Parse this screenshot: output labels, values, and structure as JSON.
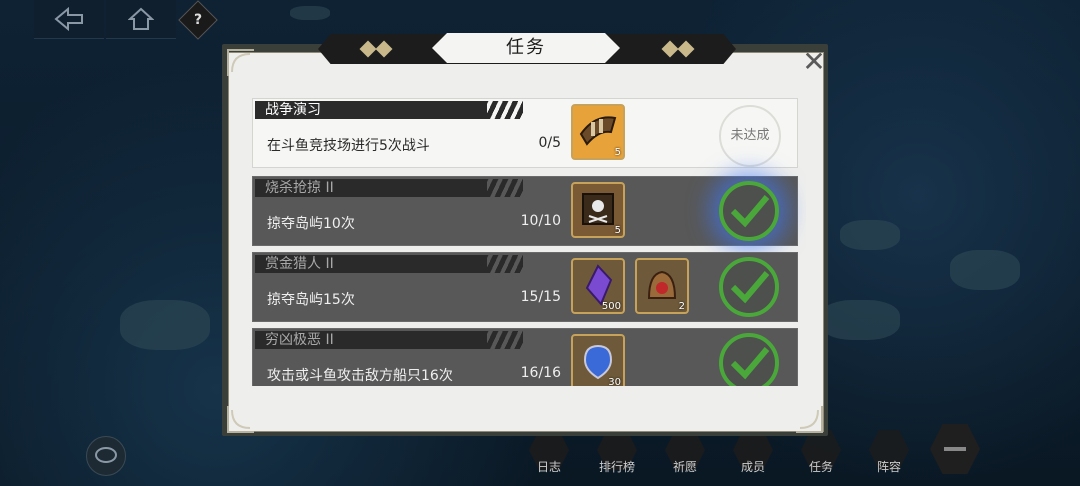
{
  "dialog": {
    "title": "任务"
  },
  "quests": [
    {
      "name": "战争演习",
      "desc": "在斗鱼竞技场进行5次战斗",
      "progress": "0/5",
      "status": "active",
      "status_label": "未达成",
      "rewards": [
        {
          "icon": "horn-icon",
          "count": "5"
        }
      ]
    },
    {
      "name": "烧杀抢掠 II",
      "desc": "掠夺岛屿10次",
      "progress": "10/10",
      "status": "done",
      "rewards": [
        {
          "icon": "pirate-map-icon",
          "count": "5"
        }
      ]
    },
    {
      "name": "赏金猎人 II",
      "desc": "掠夺岛屿15次",
      "progress": "15/15",
      "status": "done",
      "rewards": [
        {
          "icon": "purple-crystal-icon",
          "count": "500"
        },
        {
          "icon": "bell-icon",
          "count": "2"
        }
      ]
    },
    {
      "name": "穷凶极恶 II",
      "desc": "攻击或斗鱼攻击敌方船只16次",
      "progress": "16/16",
      "status": "done",
      "rewards": [
        {
          "icon": "blue-gem-icon",
          "count": "30"
        }
      ]
    }
  ],
  "bottom_bar": [
    "日志",
    "排行榜",
    "祈愿",
    "成员",
    "任务",
    "阵容"
  ],
  "colors": {
    "check_green": "#4aa83a",
    "reward_border": "#c6a25a",
    "panel_bg": "#eeeeec"
  }
}
